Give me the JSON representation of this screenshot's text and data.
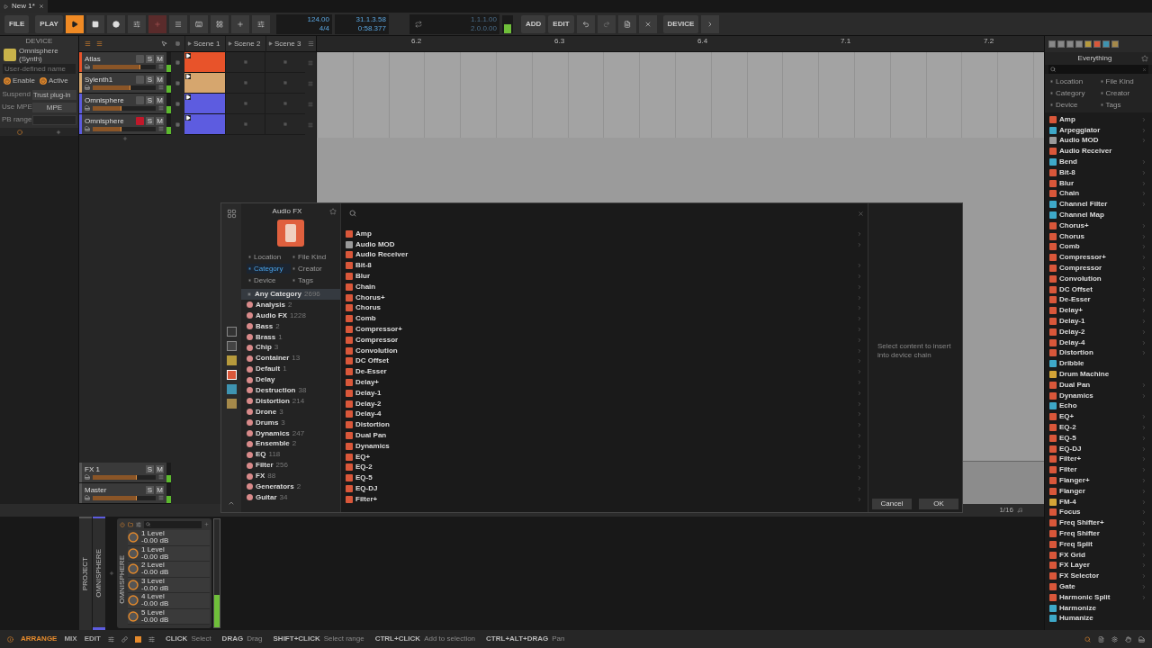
{
  "title_bar": {
    "tab": "New 1*"
  },
  "toolbar": {
    "file": "FILE",
    "play_menu": "PLAY",
    "playing": true,
    "tempo": "124.00",
    "meter": "4/4",
    "position_bars": "31.1.3.58",
    "position_time": "0:58.377",
    "loop_start": "1.1.1.00",
    "loop_end": "2.0.0.00",
    "add": "ADD",
    "edit": "EDIT",
    "device": "DEVICE"
  },
  "device_panel": {
    "header": "DEVICE",
    "plugin_name": "Omnisphere",
    "plugin_type": "(Synth)",
    "name_placeholder": "User-defined name",
    "enable": {
      "label": "Enable",
      "on": true
    },
    "active": {
      "label": "Active",
      "on": true
    },
    "suspend": {
      "label": "Suspend",
      "value": "Trust plug-in"
    },
    "mpe": {
      "label": "Use MPE",
      "value": "MPE"
    },
    "pb_range": {
      "label": "PB range"
    }
  },
  "scenes": [
    "Scene 1",
    "Scene 2",
    "Scene 3"
  ],
  "tracks": [
    {
      "name": "Atlas",
      "color": "#e8532a",
      "level": 0.75,
      "armed": false,
      "solo": "S",
      "mute": "M"
    },
    {
      "name": "Sylenth1",
      "color": "#d6a66e",
      "level": 0.6,
      "armed": false,
      "solo": "S",
      "mute": "M"
    },
    {
      "name": "Omnisphere",
      "color": "#5d5ce0",
      "level": 0.45,
      "armed": false,
      "solo": "S",
      "mute": "M"
    },
    {
      "name": "Omnisphere",
      "color": "#5d5ce0",
      "level": 0.45,
      "armed": true,
      "solo": "S",
      "mute": "M"
    }
  ],
  "effect_tracks": [
    {
      "name": "FX 1",
      "level": 0.7,
      "solo": "S",
      "mute": "M"
    },
    {
      "name": "Master",
      "level": 0.7,
      "solo": "S",
      "mute": "M"
    }
  ],
  "ruler": [
    "6.2",
    "6.3",
    "6.4",
    "7.1",
    "7.2"
  ],
  "grid": "1/16",
  "dialog": {
    "title": "Audio FX",
    "filters": [
      {
        "label": "Location",
        "selected": false
      },
      {
        "label": "File Kind",
        "selected": false
      },
      {
        "label": "Category",
        "selected": true
      },
      {
        "label": "Creator",
        "selected": false
      },
      {
        "label": "Device",
        "selected": false
      },
      {
        "label": "Tags",
        "selected": false
      }
    ],
    "any_category": {
      "label": "Any Category",
      "count": "2696",
      "selected": true
    },
    "categories": [
      {
        "name": "Analysis",
        "count": "2",
        "selected": false
      },
      {
        "name": "Audio FX",
        "count": "1228",
        "selected": false
      },
      {
        "name": "Bass",
        "count": "2",
        "selected": false
      },
      {
        "name": "Brass",
        "count": "1",
        "selected": false
      },
      {
        "name": "Chip",
        "count": "3",
        "selected": false
      },
      {
        "name": "Container",
        "count": "13",
        "selected": false
      },
      {
        "name": "Default",
        "count": "1",
        "selected": false
      },
      {
        "name": "Delay",
        "selected": false
      },
      {
        "name": "Destruction",
        "count": "38",
        "selected": false
      },
      {
        "name": "Distortion",
        "count": "214",
        "selected": false
      },
      {
        "name": "Drone",
        "count": "3",
        "selected": false
      },
      {
        "name": "Drums",
        "count": "3",
        "selected": false
      },
      {
        "name": "Dynamics",
        "count": "247",
        "selected": false
      },
      {
        "name": "Ensemble",
        "count": "2",
        "selected": false
      },
      {
        "name": "EQ",
        "count": "118",
        "selected": false
      },
      {
        "name": "Filter",
        "count": "256",
        "selected": false
      },
      {
        "name": "FX",
        "count": "88",
        "selected": false
      },
      {
        "name": "Generators",
        "count": "2",
        "selected": false
      },
      {
        "name": "Guitar",
        "count": "34",
        "selected": false
      }
    ],
    "items": [
      {
        "name": "Amp",
        "kind": "audio",
        "arrow": true
      },
      {
        "name": "Audio MOD",
        "kind": "modulator",
        "arrow": true
      },
      {
        "name": "Audio Receiver",
        "kind": "audio",
        "arrow": false
      },
      {
        "name": "Bit-8",
        "kind": "audio",
        "arrow": true
      },
      {
        "name": "Blur",
        "kind": "audio",
        "arrow": true
      },
      {
        "name": "Chain",
        "kind": "audio",
        "arrow": true
      },
      {
        "name": "Chorus+",
        "kind": "audio",
        "arrow": true
      },
      {
        "name": "Chorus",
        "kind": "audio",
        "arrow": true
      },
      {
        "name": "Comb",
        "kind": "audio",
        "arrow": true
      },
      {
        "name": "Compressor+",
        "kind": "audio",
        "arrow": true
      },
      {
        "name": "Compressor",
        "kind": "audio",
        "arrow": true
      },
      {
        "name": "Convolution",
        "kind": "audio",
        "arrow": true
      },
      {
        "name": "DC Offset",
        "kind": "audio",
        "arrow": true
      },
      {
        "name": "De-Esser",
        "kind": "audio",
        "arrow": true
      },
      {
        "name": "Delay+",
        "kind": "audio",
        "arrow": true
      },
      {
        "name": "Delay-1",
        "kind": "audio",
        "arrow": true
      },
      {
        "name": "Delay-2",
        "kind": "audio",
        "arrow": true
      },
      {
        "name": "Delay-4",
        "kind": "audio",
        "arrow": true
      },
      {
        "name": "Distortion",
        "kind": "audio",
        "arrow": true
      },
      {
        "name": "Dual Pan",
        "kind": "audio",
        "arrow": true
      },
      {
        "name": "Dynamics",
        "kind": "audio",
        "arrow": true
      },
      {
        "name": "EQ+",
        "kind": "audio",
        "arrow": true
      },
      {
        "name": "EQ-2",
        "kind": "audio",
        "arrow": true
      },
      {
        "name": "EQ-5",
        "kind": "audio",
        "arrow": true
      },
      {
        "name": "EQ-DJ",
        "kind": "audio",
        "arrow": true
      },
      {
        "name": "Filter+",
        "kind": "audio",
        "arrow": true
      }
    ],
    "hint": "Select content to insert into device chain",
    "cancel": "Cancel",
    "ok": "OK"
  },
  "browser": {
    "title": "Everything",
    "filters": [
      {
        "label": "Location",
        "selected": false
      },
      {
        "label": "File Kind",
        "selected": false
      },
      {
        "label": "Category",
        "selected": false
      },
      {
        "label": "Creator",
        "selected": false
      },
      {
        "label": "Device",
        "selected": false
      },
      {
        "label": "Tags",
        "selected": false
      }
    ],
    "items": [
      {
        "name": "Amp",
        "kind": "audio",
        "arrow": true
      },
      {
        "name": "Arpeggiator",
        "kind": "note",
        "arrow": true
      },
      {
        "name": "Audio MOD",
        "kind": "modulator",
        "arrow": true
      },
      {
        "name": "Audio Receiver",
        "kind": "audio",
        "arrow": false
      },
      {
        "name": "Bend",
        "kind": "note",
        "arrow": true
      },
      {
        "name": "Bit-8",
        "kind": "audio",
        "arrow": true
      },
      {
        "name": "Blur",
        "kind": "audio",
        "arrow": true
      },
      {
        "name": "Chain",
        "kind": "audio",
        "arrow": true
      },
      {
        "name": "Channel Filter",
        "kind": "note",
        "arrow": true
      },
      {
        "name": "Channel Map",
        "kind": "note",
        "arrow": false
      },
      {
        "name": "Chorus+",
        "kind": "audio",
        "arrow": true
      },
      {
        "name": "Chorus",
        "kind": "audio",
        "arrow": true
      },
      {
        "name": "Comb",
        "kind": "audio",
        "arrow": true
      },
      {
        "name": "Compressor+",
        "kind": "audio",
        "arrow": true
      },
      {
        "name": "Compressor",
        "kind": "audio",
        "arrow": true
      },
      {
        "name": "Convolution",
        "kind": "audio",
        "arrow": true
      },
      {
        "name": "DC Offset",
        "kind": "audio",
        "arrow": true
      },
      {
        "name": "De-Esser",
        "kind": "audio",
        "arrow": true
      },
      {
        "name": "Delay+",
        "kind": "audio",
        "arrow": true
      },
      {
        "name": "Delay-1",
        "kind": "audio",
        "arrow": true
      },
      {
        "name": "Delay-2",
        "kind": "audio",
        "arrow": true
      },
      {
        "name": "Delay-4",
        "kind": "audio",
        "arrow": true
      },
      {
        "name": "Distortion",
        "kind": "audio",
        "arrow": true
      },
      {
        "name": "Dribble",
        "kind": "note",
        "arrow": false
      },
      {
        "name": "Drum Machine",
        "kind": "instrument",
        "arrow": false
      },
      {
        "name": "Dual Pan",
        "kind": "audio",
        "arrow": true
      },
      {
        "name": "Dynamics",
        "kind": "audio",
        "arrow": true
      },
      {
        "name": "Echo",
        "kind": "note",
        "arrow": false
      },
      {
        "name": "EQ+",
        "kind": "audio",
        "arrow": true
      },
      {
        "name": "EQ-2",
        "kind": "audio",
        "arrow": true
      },
      {
        "name": "EQ-5",
        "kind": "audio",
        "arrow": true
      },
      {
        "name": "EQ-DJ",
        "kind": "audio",
        "arrow": true
      },
      {
        "name": "Filter+",
        "kind": "audio",
        "arrow": true
      },
      {
        "name": "Filter",
        "kind": "audio",
        "arrow": true
      },
      {
        "name": "Flanger+",
        "kind": "audio",
        "arrow": true
      },
      {
        "name": "Flanger",
        "kind": "audio",
        "arrow": true
      },
      {
        "name": "FM-4",
        "kind": "instrument",
        "arrow": true
      },
      {
        "name": "Focus",
        "kind": "audio",
        "arrow": true
      },
      {
        "name": "Freq Shifter+",
        "kind": "audio",
        "arrow": true
      },
      {
        "name": "Freq Shifter",
        "kind": "audio",
        "arrow": true
      },
      {
        "name": "Freq Split",
        "kind": "audio",
        "arrow": true
      },
      {
        "name": "FX Grid",
        "kind": "audio",
        "arrow": true
      },
      {
        "name": "FX Layer",
        "kind": "audio",
        "arrow": true
      },
      {
        "name": "FX Selector",
        "kind": "audio",
        "arrow": true
      },
      {
        "name": "Gate",
        "kind": "audio",
        "arrow": true
      },
      {
        "name": "Harmonic Split",
        "kind": "audio",
        "arrow": true
      },
      {
        "name": "Harmonize",
        "kind": "note",
        "arrow": false
      },
      {
        "name": "Humanize",
        "kind": "note",
        "arrow": false
      }
    ]
  },
  "device_chain": {
    "project_label": "PROJECT",
    "track_label": "OMNISPHERE",
    "device_label": "OMNISPHERE",
    "params": [
      {
        "name": "1 Level",
        "value": "-0.00 dB"
      },
      {
        "name": "1 Level",
        "value": "-0.00 dB"
      },
      {
        "name": "2 Level",
        "value": "-0.00 dB"
      },
      {
        "name": "3 Level",
        "value": "-0.00 dB"
      },
      {
        "name": "4 Level",
        "value": "-0.00 dB"
      },
      {
        "name": "5 Level",
        "value": "-0.00 dB"
      }
    ],
    "meter": {
      "level": 0.3
    }
  },
  "status_bar": {
    "modes": [
      {
        "label": "ARRANGE",
        "selected": true
      },
      {
        "label": "MIX",
        "selected": false
      },
      {
        "label": "EDIT",
        "selected": false
      }
    ],
    "hints": [
      {
        "key": "CLICK",
        "action": "Select"
      },
      {
        "key": "DRAG",
        "action": "Drag"
      },
      {
        "key": "SHIFT+CLICK",
        "action": "Select range"
      },
      {
        "key": "CTRL+CLICK",
        "action": "Add to selection"
      },
      {
        "key": "CTRL+ALT+DRAG",
        "action": "Pan"
      }
    ]
  }
}
